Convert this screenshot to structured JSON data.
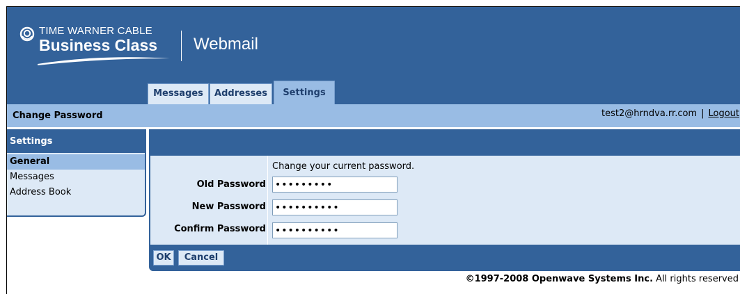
{
  "brand": {
    "top_line": "TIME WARNER CABLE",
    "main_line": "Business Class",
    "product": "Webmail",
    "bg_color": "#33629a"
  },
  "tabs": [
    {
      "label": "Messages",
      "active": false
    },
    {
      "label": "Addresses",
      "active": false
    },
    {
      "label": "Settings",
      "active": true
    }
  ],
  "titlebar": {
    "title": "Change Password",
    "user_email": "test2@hrndva.rr.com",
    "separator": "|",
    "logout_label": "Logout"
  },
  "sidebar": {
    "heading": "Settings",
    "items": [
      {
        "label": "General",
        "active": true
      },
      {
        "label": "Messages",
        "active": false
      },
      {
        "label": "Address Book",
        "active": false
      }
    ]
  },
  "form": {
    "instruction": "Change your current password.",
    "fields": [
      {
        "label": "Old Password",
        "value": "123456789"
      },
      {
        "label": "New Password",
        "value": "1234567890"
      },
      {
        "label": "Confirm Password",
        "value": "1234567890"
      }
    ],
    "ok_label": "OK",
    "cancel_label": "Cancel"
  },
  "footer": {
    "company": "©1997-2008 Openwave Systems Inc.",
    "rights": " All rights reserved"
  },
  "icons": {
    "logo": "time-warner-eye-icon"
  }
}
